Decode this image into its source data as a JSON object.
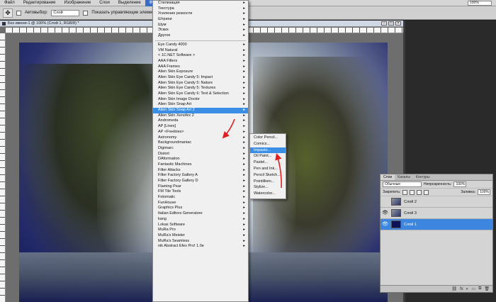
{
  "menubar": {
    "items": [
      "Файл",
      "Редактирование",
      "Изображение",
      "Слои",
      "Выделение",
      "Фильтр"
    ],
    "active_index": 5,
    "zoom": "100%"
  },
  "options": {
    "autoselect_label": "Автовыбор:",
    "autoselect_value": "Слой",
    "show_controls_label": "Показать управляющие элементы"
  },
  "document": {
    "title": "Без имени-1 @ 100% (Слой 1, RGB/8) *"
  },
  "filter_menu": {
    "items": [
      {
        "label": "Стилизация",
        "sub": true
      },
      {
        "label": "Текстура",
        "sub": true
      },
      {
        "label": "Усиление резкости",
        "sub": true
      },
      {
        "label": "Штрихи",
        "sub": true
      },
      {
        "label": "Шум",
        "sub": true
      },
      {
        "label": "Эскиз",
        "sub": true
      },
      {
        "label": "Другое",
        "sub": true
      },
      {
        "sep": true
      },
      {
        "label": "Eye Candy 4000",
        "sub": true
      },
      {
        "label": "VM Natural",
        "sub": true
      },
      {
        "label": "< 1C.NET Software >",
        "sub": true
      },
      {
        "label": "AAA Filters",
        "sub": true
      },
      {
        "label": "AAA Frames",
        "sub": true
      },
      {
        "label": "Alien Skin Exposure",
        "sub": true
      },
      {
        "label": "Alien Skin Eye Candy 5: Impact",
        "sub": true
      },
      {
        "label": "Alien Skin Eye Candy 5: Nature",
        "sub": true
      },
      {
        "label": "Alien Skin Eye Candy 5: Textures",
        "sub": true
      },
      {
        "label": "Alien Skin Eye Candy 6: Text & Selection",
        "sub": true
      },
      {
        "label": "Alien Skin Image Doctor",
        "sub": true
      },
      {
        "label": "Alien Skin Snap Art",
        "sub": true
      },
      {
        "label": "Alien Skin Snap Art 2",
        "sub": true,
        "highlight": true
      },
      {
        "label": "Alien Skin Xenofex 2",
        "sub": true
      },
      {
        "label": "Andromeda",
        "sub": true
      },
      {
        "label": "AP [Lines]",
        "sub": true
      },
      {
        "label": "AP <Freebies>",
        "sub": true
      },
      {
        "label": "Astronomy",
        "sub": true
      },
      {
        "label": "Backgroundmaniac",
        "sub": true
      },
      {
        "label": "Digimarc",
        "sub": true
      },
      {
        "label": "Distort",
        "sub": true
      },
      {
        "label": "DAformation",
        "sub": true
      },
      {
        "label": "Fantastic Machines",
        "sub": true
      },
      {
        "label": "Filter Attacks",
        "sub": true
      },
      {
        "label": "Filter Factory Gallery A",
        "sub": true
      },
      {
        "label": "Filter Factory Gallery D",
        "sub": true
      },
      {
        "label": "Flaming Pear",
        "sub": true
      },
      {
        "label": "FM Tile Tools",
        "sub": true
      },
      {
        "label": "Fotomatic",
        "sub": true
      },
      {
        "label": "FunHouse",
        "sub": true
      },
      {
        "label": "Graphics Plus",
        "sub": true
      },
      {
        "label": "Italian Editors Generatore",
        "sub": true
      },
      {
        "label": "kang",
        "sub": true
      },
      {
        "label": "Lokas Software",
        "sub": true
      },
      {
        "label": "MuRa Pro",
        "sub": true
      },
      {
        "label": "MuRa's Meister",
        "sub": true
      },
      {
        "label": "MuRa's Seamless",
        "sub": true
      },
      {
        "label": "nik Abstract Efex Pro! 1.0e",
        "sub": true
      }
    ]
  },
  "submenu": {
    "items": [
      {
        "label": "Color Pencil..."
      },
      {
        "label": "Comics..."
      },
      {
        "label": "Impasto...",
        "highlight": true
      },
      {
        "label": "Oil Paint..."
      },
      {
        "label": "Pastel..."
      },
      {
        "label": "Pen and Ink..."
      },
      {
        "label": "Pencil Sketch..."
      },
      {
        "label": "Pointillism..."
      },
      {
        "label": "Stylize..."
      },
      {
        "label": "Watercolor..."
      }
    ]
  },
  "layers_panel": {
    "tabs": [
      "Слои",
      "Каналы",
      "Контуры"
    ],
    "blend_mode": "Обычные",
    "opacity_label": "Непрозрачность:",
    "opacity_value": "100%",
    "lock_label": "Закрепить:",
    "fill_label": "Заливка:",
    "fill_value": "100%",
    "layers": [
      {
        "name": "Слой 2",
        "visible": false,
        "selected": false
      },
      {
        "name": "Слой 3",
        "visible": true,
        "selected": false
      },
      {
        "name": "Слой 1",
        "visible": true,
        "selected": true
      }
    ]
  }
}
